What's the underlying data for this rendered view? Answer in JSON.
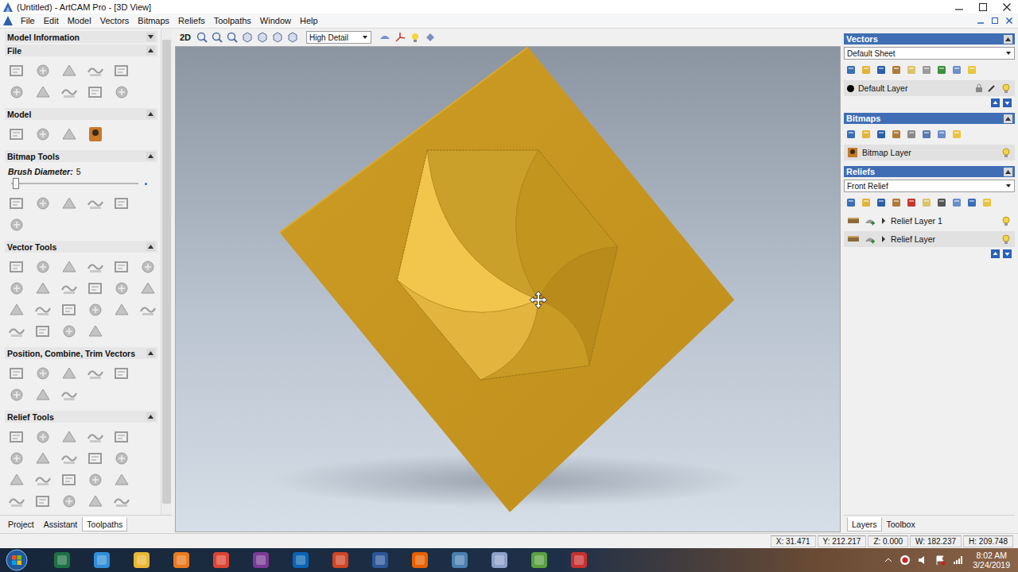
{
  "window": {
    "title": "(Untitled) - ArtCAM Pro - [3D View]"
  },
  "menu": [
    "File",
    "Edit",
    "Model",
    "Vectors",
    "Bitmaps",
    "Reliefs",
    "Toolpaths",
    "Window",
    "Help"
  ],
  "left_panel": {
    "header": {
      "title": "Model Information",
      "expanded": false
    },
    "sections": [
      {
        "title": "File",
        "expanded": true
      },
      {
        "title": "Model",
        "expanded": true
      },
      {
        "title": "Bitmap Tools",
        "expanded": true
      },
      {
        "title": "Vector Tools",
        "expanded": true
      },
      {
        "title": "Position, Combine, Trim Vectors",
        "expanded": true
      },
      {
        "title": "Relief Tools",
        "expanded": true
      }
    ],
    "brush": {
      "label": "Brush Diameter:",
      "value": "5",
      "level": 0.03
    },
    "tabs": [
      {
        "label": "Project",
        "selected": false
      },
      {
        "label": "Assistant",
        "selected": false
      },
      {
        "label": "Toolpaths",
        "selected": true
      }
    ]
  },
  "view_toolbar": {
    "mode": "2D",
    "detail": "High Detail"
  },
  "right_panel": {
    "vectors": {
      "title": "Vectors",
      "sheet": "Default Sheet",
      "layers": [
        {
          "name": "Default Layer",
          "selected": true
        }
      ]
    },
    "bitmaps": {
      "title": "Bitmaps",
      "layers": [
        {
          "name": "Bitmap Layer",
          "selected": true
        }
      ]
    },
    "reliefs": {
      "title": "Reliefs",
      "sheet": "Front Relief",
      "layers": [
        {
          "name": "Relief Layer 1",
          "selected": false,
          "expanded": false
        },
        {
          "name": "Relief Layer",
          "selected": true,
          "expanded": false
        }
      ]
    },
    "tabs": [
      {
        "label": "Layers",
        "selected": true
      },
      {
        "label": "Toolbox",
        "selected": false
      }
    ]
  },
  "status_bar": [
    "X: 31.471",
    "Y: 212.217",
    "Z: 0.000",
    "W: 182.237",
    "H: 209.748"
  ],
  "taskbar": {
    "time": "8:02 AM",
    "date": "3/24/2019"
  }
}
